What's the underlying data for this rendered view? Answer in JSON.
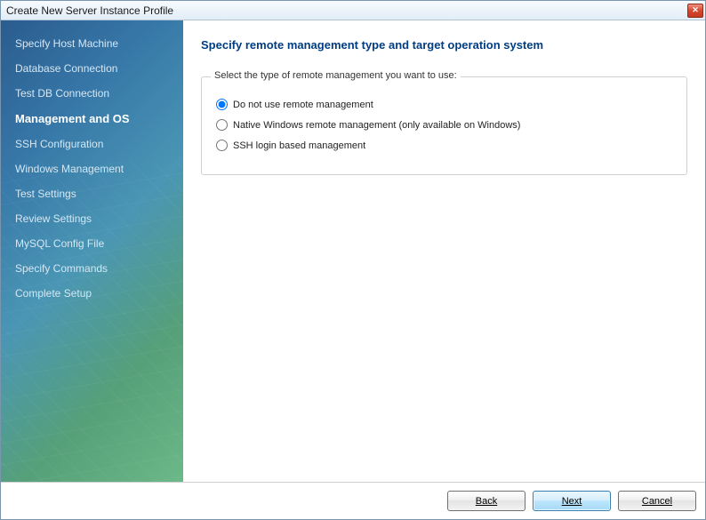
{
  "window": {
    "title": "Create New Server Instance Profile"
  },
  "sidebar": {
    "items": [
      {
        "label": "Specify Host Machine",
        "active": false
      },
      {
        "label": "Database Connection",
        "active": false
      },
      {
        "label": "Test DB Connection",
        "active": false
      },
      {
        "label": "Management and OS",
        "active": true
      },
      {
        "label": "SSH Configuration",
        "active": false
      },
      {
        "label": "Windows Management",
        "active": false
      },
      {
        "label": "Test Settings",
        "active": false
      },
      {
        "label": "Review Settings",
        "active": false
      },
      {
        "label": "MySQL Config File",
        "active": false
      },
      {
        "label": "Specify Commands",
        "active": false
      },
      {
        "label": "Complete Setup",
        "active": false
      }
    ]
  },
  "main": {
    "heading": "Specify remote management type and target operation system",
    "legend": "Select the type of remote management you want to use:",
    "options": [
      {
        "label": "Do not use remote management",
        "selected": true
      },
      {
        "label": "Native Windows remote management (only available on Windows)",
        "selected": false
      },
      {
        "label": "SSH login based management",
        "selected": false
      }
    ]
  },
  "footer": {
    "back": "Back",
    "next": "Next",
    "cancel": "Cancel"
  }
}
